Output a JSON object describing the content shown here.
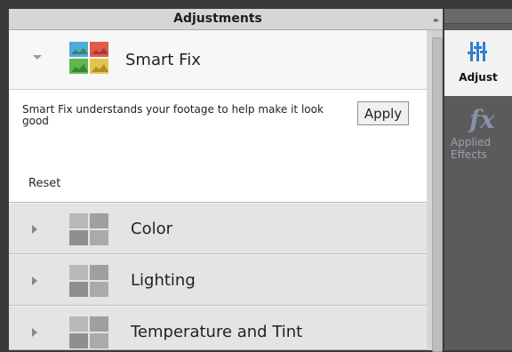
{
  "panel": {
    "title": "Adjustments"
  },
  "smart_fix": {
    "title": "Smart Fix",
    "description": "Smart Fix understands your footage to help make it look good",
    "apply_label": "Apply",
    "reset_label": "Reset"
  },
  "sections": [
    {
      "label": "Color"
    },
    {
      "label": "Lighting"
    },
    {
      "label": "Temperature and Tint"
    }
  ],
  "sidebar": {
    "adjust_label": "Adjust",
    "effects_icon_text": "fx",
    "effects_label": "Applied Effects"
  },
  "colors": {
    "accent_blue": "#2f7fd0",
    "thumb_colors": [
      "#5fbf53",
      "#e7554b",
      "#e0c74a",
      "#3b9fd8"
    ]
  }
}
